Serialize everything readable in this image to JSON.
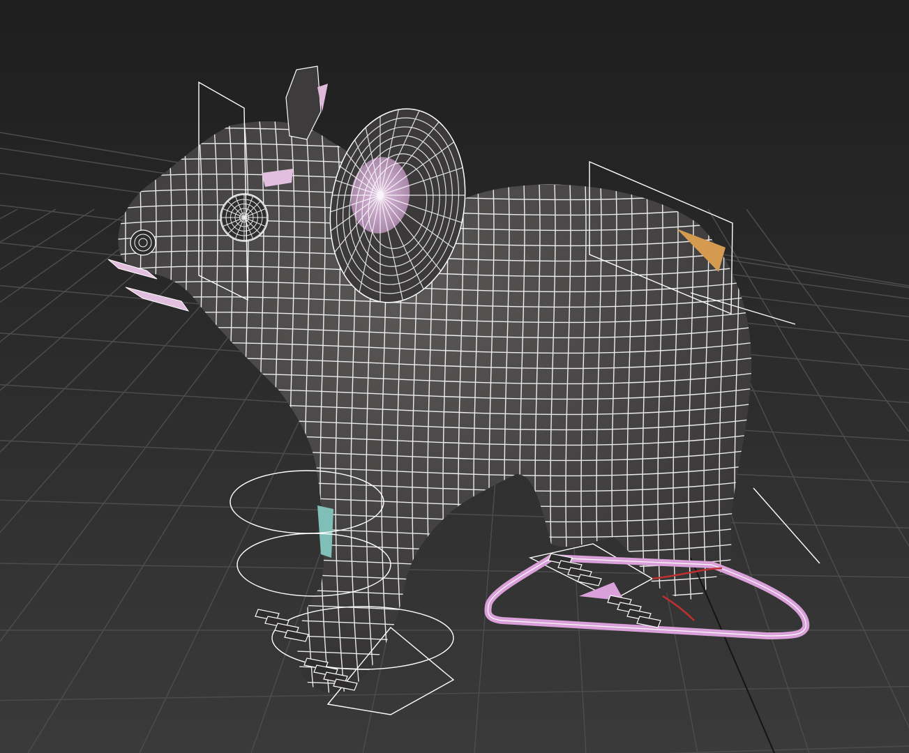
{
  "viewport": {
    "background_top": "#1f1f1f",
    "background_bottom": "#3a3a3a",
    "grid_color": "#4a4a4a",
    "wire_color": "#ffffff",
    "fur_color": "#3a3838",
    "ear_inner_color": "#c9a3c9",
    "bone_pink": "#e0b8d8",
    "bone_orange": "#d49a50",
    "bone_teal": "#7fbfb8",
    "ik_control_color": "#d9a0d9",
    "ik_red_color": "#c03030"
  }
}
